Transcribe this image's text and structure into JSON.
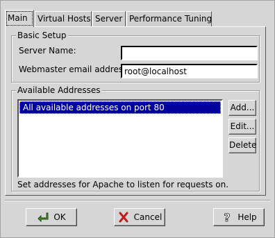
{
  "tabs": [
    {
      "label": "Main"
    },
    {
      "label": "Virtual Hosts"
    },
    {
      "label": "Server"
    },
    {
      "label": "Performance Tuning"
    }
  ],
  "basic_setup": {
    "title": "Basic Setup",
    "server_name_label": "Server Name:",
    "server_name_value": "",
    "webmaster_label": "Webmaster email address:",
    "webmaster_value": "root@localhost"
  },
  "addresses": {
    "title": "Available Addresses",
    "items": [
      "All available addresses on port 80"
    ],
    "add_label": "Add...",
    "edit_label": "Edit...",
    "delete_label": "Delete",
    "hint": "Set addresses for Apache to listen for requests on."
  },
  "buttons": {
    "ok_label": "OK",
    "cancel_label": "Cancel",
    "help_label": "Help"
  },
  "colors": {
    "background": "#d6d6d6",
    "selection": "#00009c"
  }
}
